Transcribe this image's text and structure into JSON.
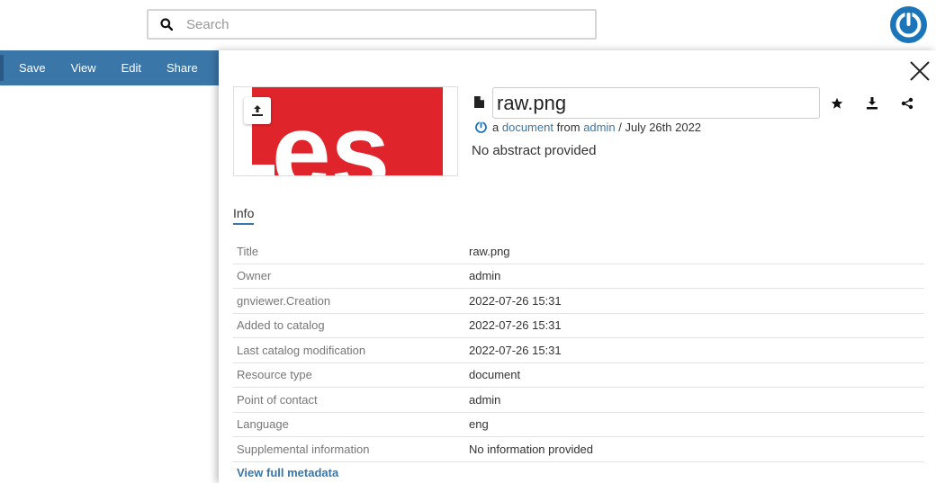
{
  "search": {
    "placeholder": "Search"
  },
  "toolbar": {
    "items": [
      "Save",
      "View",
      "Edit",
      "Share"
    ]
  },
  "resource": {
    "title_value": "raw.png",
    "byline_prefix": "a",
    "byline_type": "document",
    "byline_from": "from",
    "byline_owner": "admin",
    "byline_date": "/ July 26th 2022",
    "abstract": "No abstract provided"
  },
  "tabs": {
    "info": "Info"
  },
  "info_rows": [
    {
      "label": "Title",
      "value": "raw.png",
      "link": false
    },
    {
      "label": "Owner",
      "value": "admin",
      "link": true
    },
    {
      "label": "gnviewer.Creation",
      "value": "2022-07-26 15:31",
      "link": false
    },
    {
      "label": "Added to catalog",
      "value": "2022-07-26 15:31",
      "link": false
    },
    {
      "label": "Last catalog modification",
      "value": "2022-07-26 15:31",
      "link": false
    },
    {
      "label": "Resource type",
      "value": "document",
      "link": true
    },
    {
      "label": "Point of contact",
      "value": "admin",
      "link": true
    },
    {
      "label": "Language",
      "value": "eng",
      "link": false
    },
    {
      "label": "Supplemental information",
      "value": "No information provided",
      "link": false
    }
  ],
  "links": {
    "view_full_metadata": "View full metadata"
  },
  "thumbnail": {
    "text": "es"
  },
  "colors": {
    "accent": "#3b76a8",
    "brand": "#1b75b8",
    "thumb_red": "#e0242b"
  },
  "icons": [
    "search-icon",
    "power-logo-icon",
    "close-icon",
    "upload-icon",
    "file-icon",
    "star-icon",
    "download-icon",
    "share-icon"
  ]
}
